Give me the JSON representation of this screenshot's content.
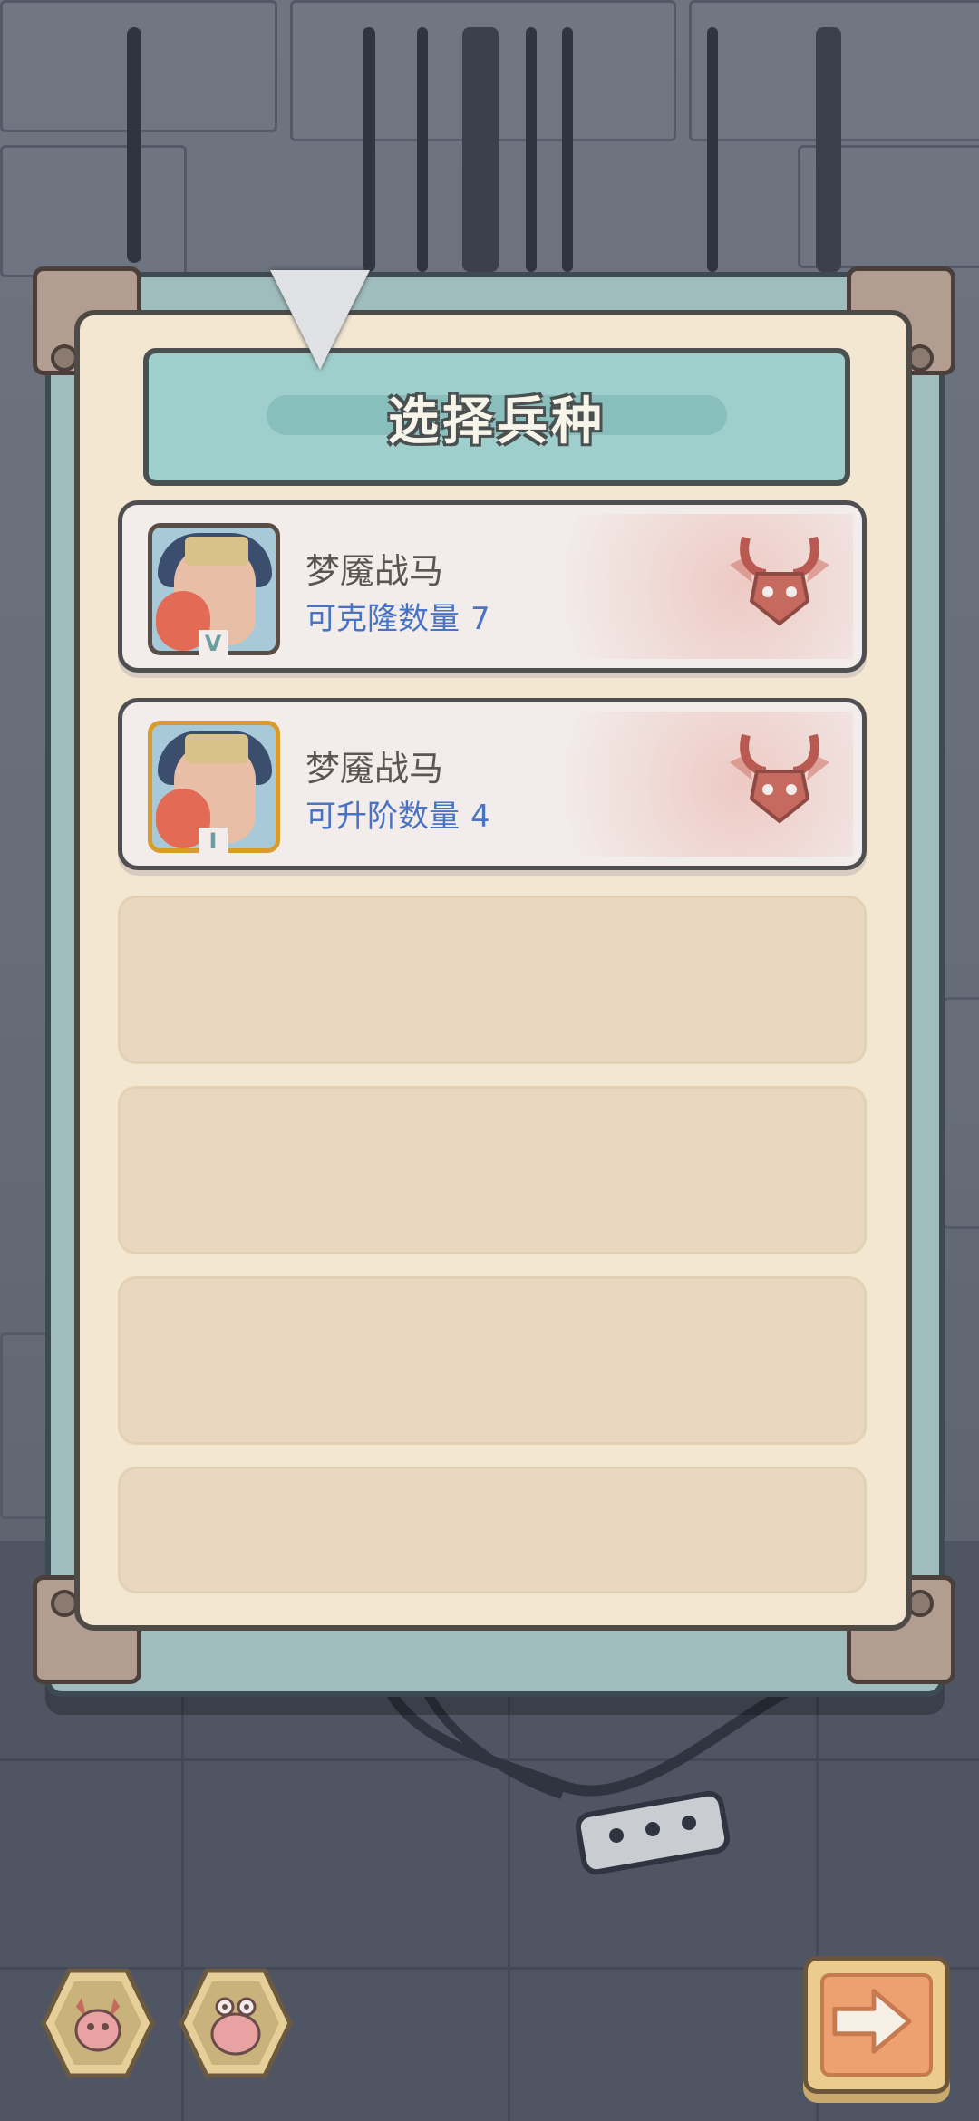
{
  "screen": {
    "title": "选择兵种"
  },
  "units": [
    {
      "name": "梦魇战马",
      "stat_label": "可克隆数量",
      "stat_value": "7",
      "rank_badge": "V",
      "frame": "normal",
      "faction_icon": "demon-bull-icon"
    },
    {
      "name": "梦魇战马",
      "stat_label": "可升阶数量",
      "stat_value": "4",
      "rank_badge": "I",
      "frame": "gold",
      "faction_icon": "demon-bull-icon"
    }
  ],
  "empty_slots": 4,
  "bottom_buttons": {
    "left_1_icon": "demon-bull-icon",
    "left_2_icon": "alien-creature-icon",
    "next_icon": "arrow-right-icon"
  },
  "colors": {
    "title_bar": "#9fcfcc",
    "panel": "#f3e7d2",
    "stat_text": "#4b73c4",
    "gold_frame": "#d99b2b"
  }
}
